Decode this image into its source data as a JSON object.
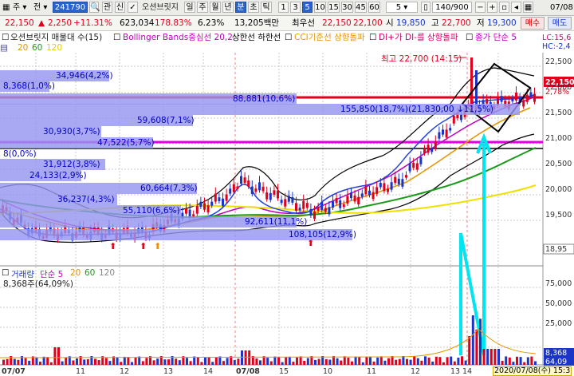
{
  "toolbar": {
    "code": "241790",
    "stock_name": "오션브릿지",
    "period_tabs": [
      "일",
      "주",
      "월",
      "년",
      "분",
      "초",
      "틱"
    ],
    "selected_tab": "분",
    "interval_options": [
      "1",
      "3",
      "5",
      "10",
      "15",
      "30",
      "45",
      "60"
    ],
    "selected_interval": "5",
    "count": "140/900",
    "right_date": "07/08"
  },
  "quote": {
    "price": "22,150",
    "change": "2,250",
    "change_pct": "+11.31%",
    "volume": "623,034",
    "volume_ratio": "178.83%",
    "turnover_pct": "6.23%",
    "amount": "13,205백만",
    "best_ask_label": "최우선",
    "ask": "22,150",
    "bid": "22,100",
    "open_label": "시",
    "open": "19,850",
    "high_label": "고",
    "high": "22,700",
    "low_label": "저",
    "low": "19,300",
    "buy_button": "매수",
    "sell_button": "매도"
  },
  "legend": {
    "title": "오션브릿지 매물대 수(15)",
    "bollinger": "Bollinger Bands중심선 20,2",
    "upper_lower": "상한선 하한선",
    "cci": "CCI기준선 상향돌파",
    "di": "DI+가 DI-를 상향돌파",
    "ma": "종가 단순 5",
    "ma_periods": [
      "20",
      "60",
      "120"
    ],
    "lc": "LC:15,6",
    "hc": "HC:-2,4"
  },
  "chart": {
    "high_note": "최고 22,700 (14:15)",
    "volume_profile": [
      {
        "label": "34,946(4,2%)",
        "width": 135
      },
      {
        "label": "8,368(1,0%)",
        "width": 60
      },
      {
        "label": "88,881(10,6%)",
        "width": 370
      },
      {
        "label": "155,850(18,7%)(21,830,00 ↓11,5%)",
        "width": 650
      },
      {
        "label": "59,608(7,1%)",
        "width": 240
      },
      {
        "label": "30,930(3,7%)",
        "width": 125
      },
      {
        "label": "47,522(5,7%)",
        "width": 190
      },
      {
        "label": "8(0,0%)",
        "width": 4
      },
      {
        "label": "31,912(3,8%)",
        "width": 130
      },
      {
        "label": "24,133(2,9%)",
        "width": 100
      },
      {
        "label": "60,664(7,3%)",
        "width": 245
      },
      {
        "label": "36,237(4,3%)",
        "width": 145
      },
      {
        "label": "55,110(6,6%)",
        "width": 225
      },
      {
        "label": "92,611(11,1%)",
        "width": 370
      },
      {
        "label": "108,105(12,9%)",
        "width": 440
      }
    ],
    "price_axis": [
      "22,500",
      "22,000",
      "21,500",
      "21,000",
      "20,500",
      "20,000",
      "19,500"
    ],
    "current_price_tag": "22,150",
    "current_pct_tag": "2,78%",
    "low_tag": "18,95",
    "volume_legend_title": "거래량",
    "volume_legend_ma": "단순 5",
    "volume_legend_periods": [
      "20",
      "60",
      "120"
    ],
    "volume_value": "8,368주(64,09%)",
    "volume_axis": [
      "75,000",
      "50,000",
      "25,000"
    ],
    "volume_tag_1": "8,368",
    "volume_tag_2": "64,09",
    "dates": [
      "07/07",
      "11",
      "12",
      "13",
      "14",
      "15",
      "07/08",
      "10",
      "11",
      "12",
      "13",
      "14"
    ],
    "cursor_time": "2020/07/08(수) 15:3"
  }
}
